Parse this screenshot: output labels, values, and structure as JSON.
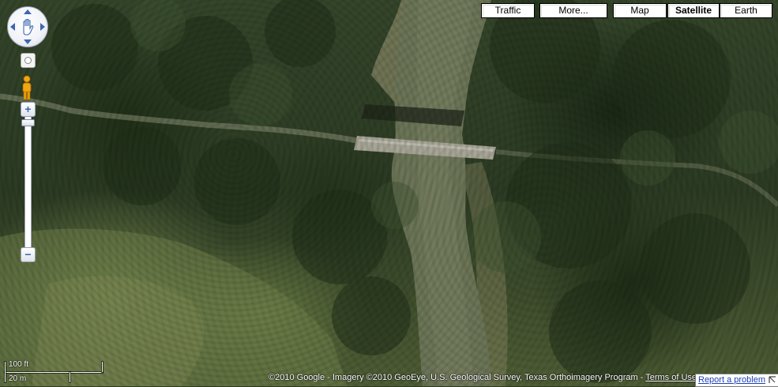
{
  "map_type_buttons": [
    {
      "label": "Traffic",
      "selected": false
    },
    {
      "label": "More...",
      "selected": false
    },
    {
      "label": "Map",
      "selected": false
    },
    {
      "label": "Satellite",
      "selected": true
    },
    {
      "label": "Earth",
      "selected": false
    }
  ],
  "navigation": {
    "pan_icon": "hand-icon",
    "pegman_icon": "pegman-icon",
    "zoom_in_label": "+",
    "zoom_out_label": "−"
  },
  "scale": {
    "imperial": "100 ft",
    "metric": "20 m"
  },
  "attribution": {
    "copyright": "©2010 Google - Imagery ©2010 GeoEye, U.S. Geological Survey, Texas Orthoimagery Program - ",
    "terms_label": "Terms of Use"
  },
  "report": {
    "label": "Report a problem"
  },
  "colors": {
    "river": "#6b7456",
    "bridge": "#9a9a8c",
    "forest_dark": "#26361d",
    "grassland": "#6e7d48",
    "control_blue": "#3c66b3"
  }
}
